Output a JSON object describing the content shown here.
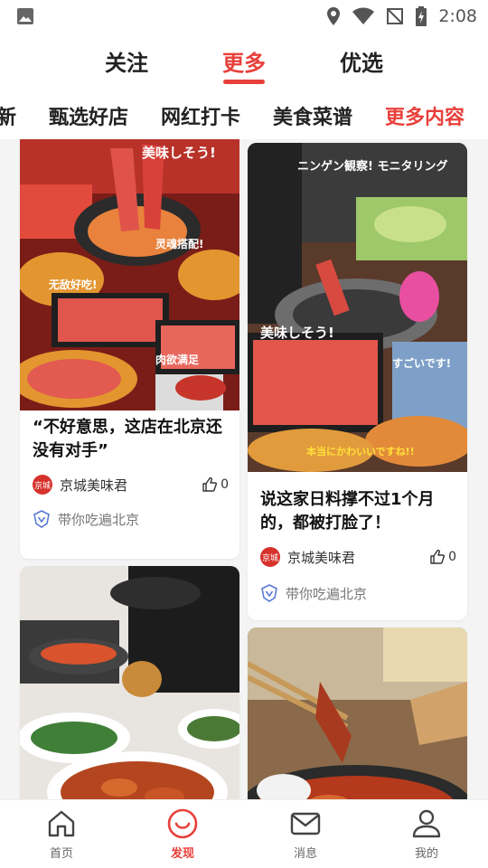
{
  "status_bar": {
    "time": "2:08"
  },
  "top_tabs": [
    {
      "label": "关注"
    },
    {
      "label": "更多"
    },
    {
      "label": "优选"
    }
  ],
  "categories": [
    {
      "label": "新"
    },
    {
      "label": "甄选好店"
    },
    {
      "label": "网红打卡"
    },
    {
      "label": "美食菜谱"
    },
    {
      "label": "更多内容"
    }
  ],
  "feed": [
    {
      "title": "“不好意思，这店在北京还没有对手”",
      "author": "京城美味君",
      "avatar_text": "京城",
      "likes": "0",
      "tag": "带你吃遍北京"
    },
    {
      "title": "说这家日料撑不过1个月的，都被打脸了！",
      "author": "京城美味君",
      "avatar_text": "京城",
      "likes": "0",
      "tag": "带你吃遍北京"
    }
  ],
  "photo_text": {
    "card1": [
      "美味しそう!",
      "灵魂搭配!",
      "无敌好吃!",
      "肉欲满足"
    ],
    "card2": [
      "ニンゲン観察! モニタリング",
      "美味しそう!",
      "すごいです!",
      "本当にかわいいですね!!"
    ]
  },
  "bottom_nav": [
    {
      "label": "首页",
      "icon": "home-icon"
    },
    {
      "label": "发现",
      "icon": "discover-icon"
    },
    {
      "label": "消息",
      "icon": "message-icon"
    },
    {
      "label": "我的",
      "icon": "profile-icon"
    }
  ],
  "colors": {
    "accent": "#e8403b",
    "background": "#f4f4f4"
  }
}
